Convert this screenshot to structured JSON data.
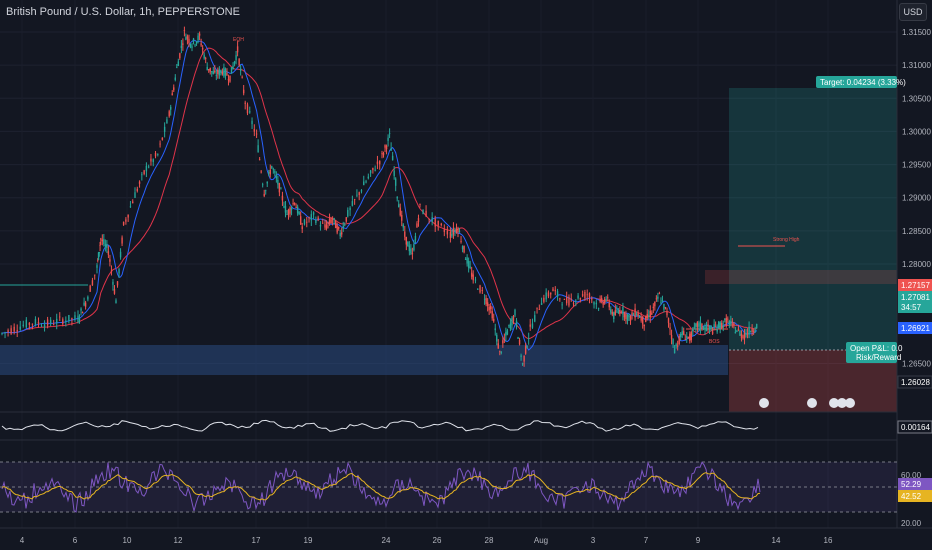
{
  "header": {
    "symbol_title": "British Pound / U.S. Dollar, 1h, PEPPERSTONE",
    "currency": "USD"
  },
  "chart_data": {
    "type": "line",
    "title": "British Pound / U.S. Dollar, 1h, PEPPERSTONE",
    "price_ticks": [
      "1.31500",
      "1.31000",
      "1.30500",
      "1.30000",
      "1.29500",
      "1.29000",
      "1.28500",
      "1.28000",
      "1.26500"
    ],
    "price_ylim": [
      1.2595,
      1.3165
    ],
    "date_ticks": [
      "4",
      "6",
      "10",
      "12",
      "17",
      "19",
      "24",
      "26",
      "28",
      "Aug",
      "3",
      "7",
      "9",
      "14",
      "16"
    ],
    "price_series": [
      [
        0,
        1.2695
      ],
      [
        0.02,
        1.2705
      ],
      [
        0.04,
        1.2712
      ],
      [
        0.06,
        1.271
      ],
      [
        0.08,
        1.2716
      ],
      [
        0.1,
        1.2718
      ],
      [
        0.11,
        1.2742
      ],
      [
        0.125,
        1.2795
      ],
      [
        0.13,
        1.2838
      ],
      [
        0.14,
        1.282
      ],
      [
        0.15,
        1.2745
      ],
      [
        0.16,
        1.2858
      ],
      [
        0.175,
        1.2905
      ],
      [
        0.19,
        1.2945
      ],
      [
        0.205,
        1.2965
      ],
      [
        0.22,
        1.3025
      ],
      [
        0.23,
        1.3095
      ],
      [
        0.24,
        1.3148
      ],
      [
        0.25,
        1.3132
      ],
      [
        0.26,
        1.3142
      ],
      [
        0.27,
        1.3098
      ],
      [
        0.28,
        1.3085
      ],
      [
        0.29,
        1.3092
      ],
      [
        0.3,
        1.3082
      ],
      [
        0.31,
        1.3122
      ],
      [
        0.32,
        1.3045
      ],
      [
        0.335,
        1.2992
      ],
      [
        0.345,
        1.2908
      ],
      [
        0.355,
        1.2948
      ],
      [
        0.365,
        1.2915
      ],
      [
        0.375,
        1.2875
      ],
      [
        0.385,
        1.2895
      ],
      [
        0.395,
        1.2858
      ],
      [
        0.41,
        1.2872
      ],
      [
        0.425,
        1.2855
      ],
      [
        0.435,
        1.2868
      ],
      [
        0.445,
        1.2845
      ],
      [
        0.455,
        1.2875
      ],
      [
        0.47,
        1.2908
      ],
      [
        0.485,
        1.2935
      ],
      [
        0.5,
        1.2962
      ],
      [
        0.51,
        1.2992
      ],
      [
        0.52,
        1.2905
      ],
      [
        0.53,
        1.2842
      ],
      [
        0.54,
        1.2812
      ],
      [
        0.55,
        1.2885
      ],
      [
        0.57,
        1.2862
      ],
      [
        0.59,
        1.2845
      ],
      [
        0.6,
        1.2855
      ],
      [
        0.61,
        1.2812
      ],
      [
        0.62,
        1.2778
      ],
      [
        0.635,
        1.2752
      ],
      [
        0.645,
        1.2725
      ],
      [
        0.655,
        1.2665
      ],
      [
        0.665,
        1.2698
      ],
      [
        0.675,
        1.2725
      ],
      [
        0.685,
        1.2648
      ],
      [
        0.695,
        1.2702
      ],
      [
        0.71,
        1.2745
      ],
      [
        0.725,
        1.276
      ],
      [
        0.74,
        1.2742
      ],
      [
        0.755,
        1.2748
      ],
      [
        0.77,
        1.2755
      ],
      [
        0.785,
        1.2738
      ],
      [
        0.795,
        1.2748
      ],
      [
        0.805,
        1.2722
      ],
      [
        0.815,
        1.2732
      ],
      [
        0.825,
        1.2718
      ],
      [
        0.835,
        1.2728
      ],
      [
        0.845,
        1.2712
      ],
      [
        0.855,
        1.2728
      ],
      [
        0.865,
        1.2752
      ],
      [
        0.875,
        1.2725
      ],
      [
        0.885,
        1.2672
      ],
      [
        0.895,
        1.2695
      ],
      [
        0.905,
        1.2688
      ],
      [
        0.915,
        1.2708
      ],
      [
        0.925,
        1.2705
      ],
      [
        0.935,
        1.2701
      ],
      [
        0.945,
        1.2708
      ],
      [
        0.955,
        1.2714
      ],
      [
        0.965,
        1.2702
      ],
      [
        0.975,
        1.2692
      ],
      [
        0.985,
        1.2701
      ],
      [
        0.995,
        1.2708
      ]
    ],
    "levels": {
      "target_label": "Target: 0.04234 (3.33%)",
      "price_top": "1.27157",
      "price_mid1": "1.27081",
      "countdown": "34:57",
      "price_mid2": "1.26921",
      "stop": "1.26028",
      "pnl_line1": "Open P&L: 0.0",
      "pnl_line2": "Risk/Reward"
    },
    "annotations": {
      "eqh": "EQH",
      "bos": "BOS",
      "swing": "Strong High"
    },
    "osc1_value": "0.00164",
    "rsi_ticks": [
      "60.00",
      "20.00"
    ],
    "rsi_values": [
      "52.29",
      "42.52"
    ],
    "colors": {
      "bull": "#26a69a",
      "bear": "#ef5350",
      "ma_fast": "#2962ff",
      "ma_slow": "#e0344a",
      "rsi": "#7e57c2",
      "signal": "#e6b422",
      "target_fill": "#26a69a",
      "stop_fill": "#ef5350",
      "zone": "#2a4a80"
    }
  }
}
